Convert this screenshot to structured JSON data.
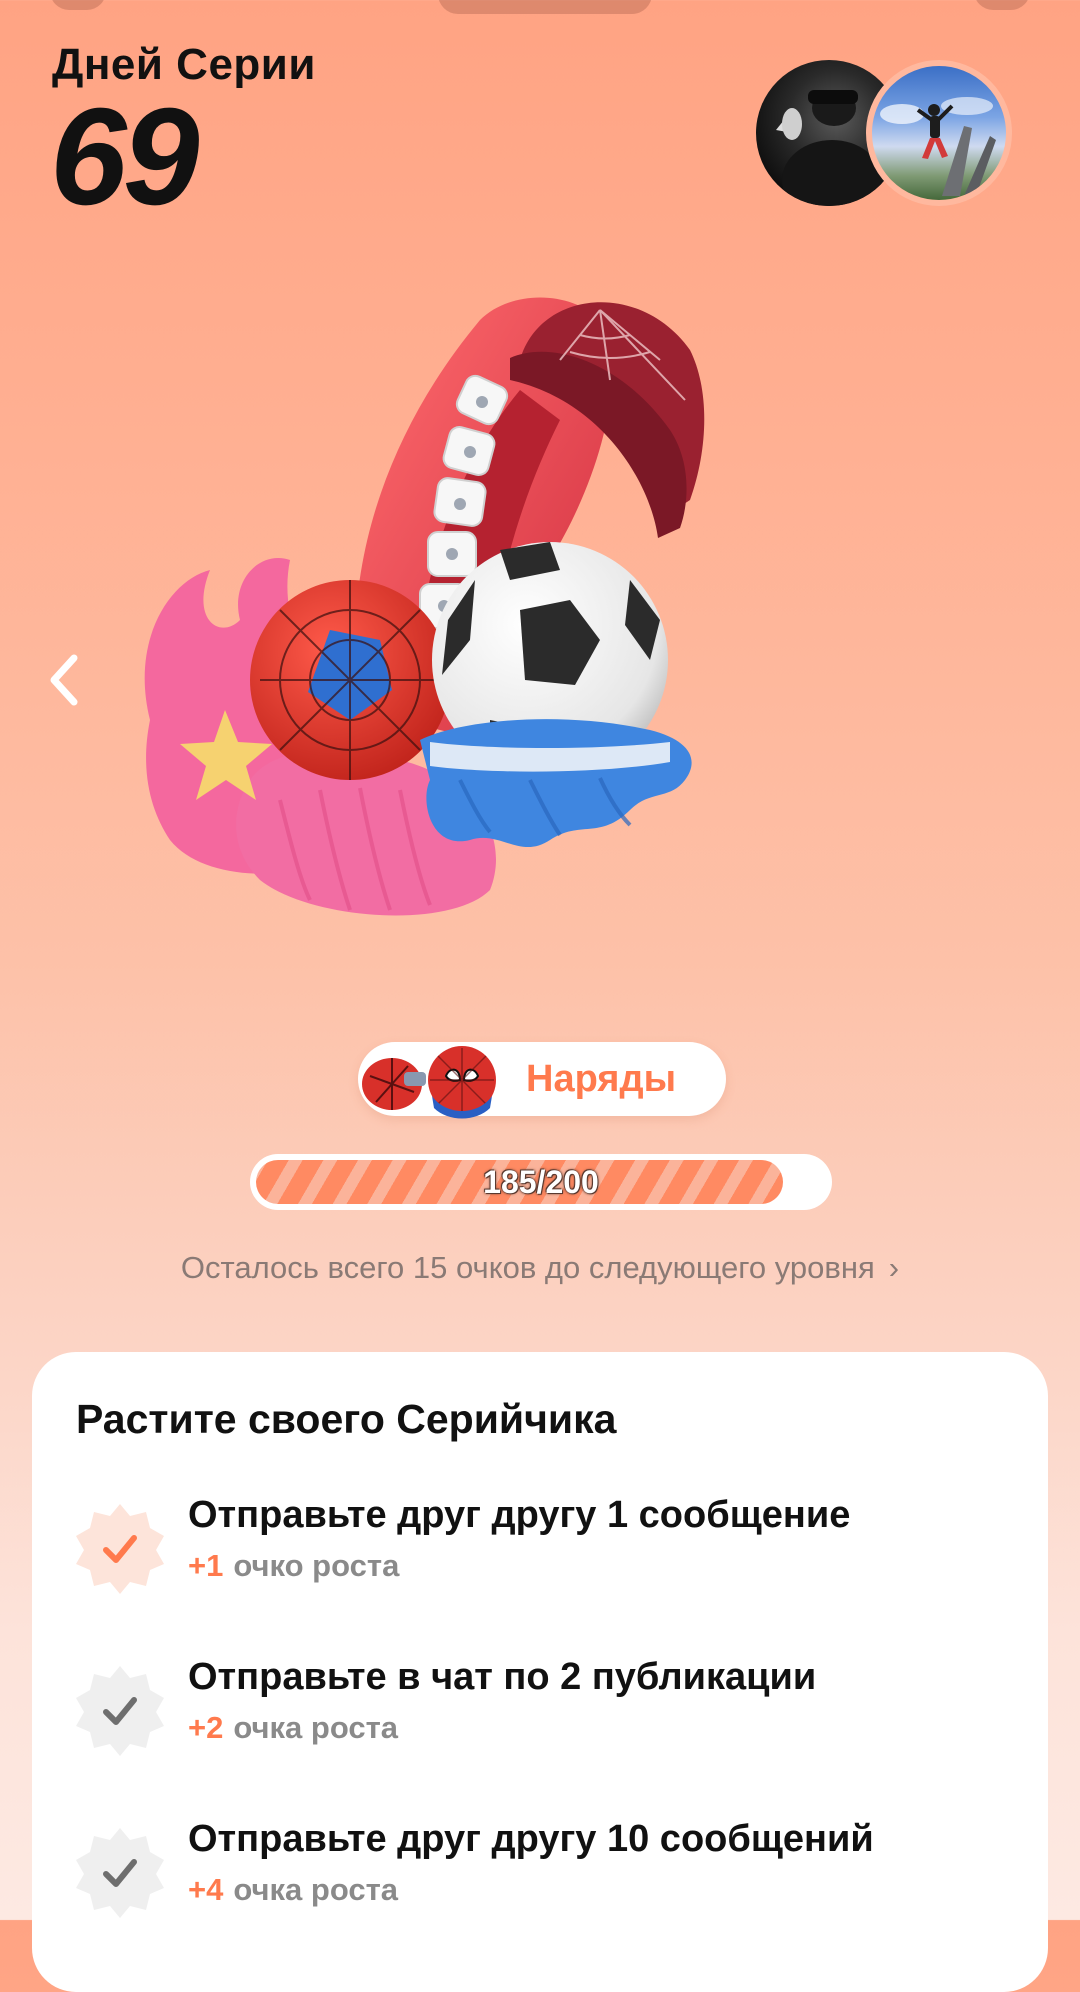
{
  "header": {
    "streak_label": "Дней Серии",
    "streak_count": "69"
  },
  "outfits": {
    "label": "Наряды"
  },
  "progress": {
    "text": "185/200",
    "current": 185,
    "total": 200,
    "fraction": 0.925,
    "remaining_text": "Осталось всего 15 очков до следующего уровня"
  },
  "tasks_card": {
    "title": "Растите своего Серийчика",
    "tasks": [
      {
        "title": "Отправьте друг другу 1 сообщение",
        "points": "+1",
        "unit": "очко роста",
        "completed": true
      },
      {
        "title": "Отправьте в чат по 2 публикации",
        "points": "+2",
        "unit": "очка роста",
        "completed": false
      },
      {
        "title": "Отправьте друг другу 10 сообщений",
        "points": "+4",
        "unit": "очка роста",
        "completed": false
      }
    ]
  },
  "colors": {
    "accent": "#ff7a4d",
    "background_top": "#ffa383",
    "background_bottom": "#fde9e2"
  },
  "icons": {
    "back": "chevron-left-icon",
    "more": "chevron-right-icon",
    "task_done": "check-badge-icon",
    "task_pending": "check-badge-icon"
  }
}
